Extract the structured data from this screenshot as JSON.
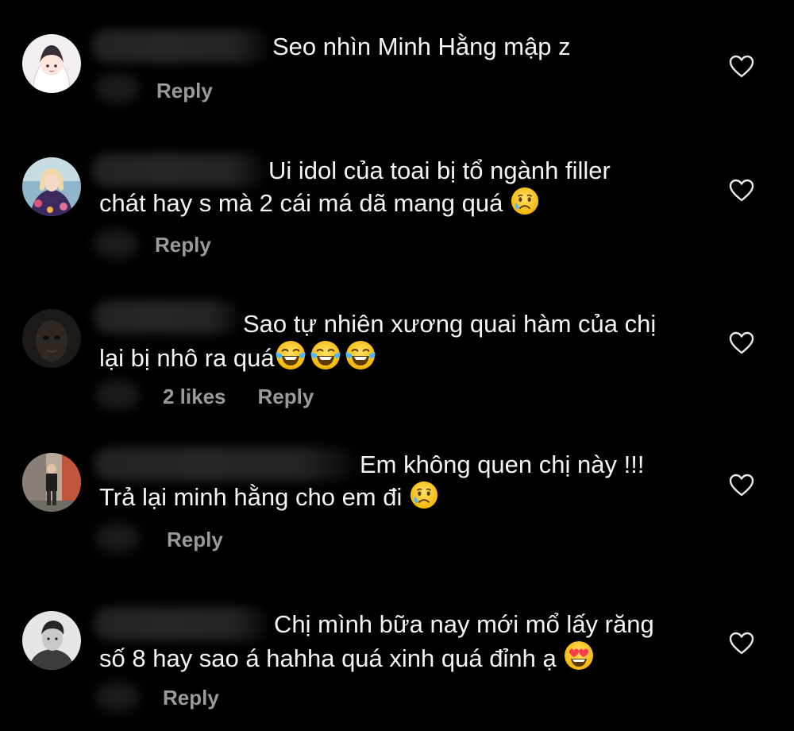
{
  "comments": [
    {
      "text_line1": "Seo nhìn Minh Hằng mập z",
      "text_line2": "",
      "likes": "",
      "reply_label": "Reply",
      "avatar": "cartoon-girl-white-hood",
      "emoji": []
    },
    {
      "text_line1": "Ui idol của toai bị tổ ngành filler",
      "text_line2": "chát hay s mà 2 cái má dã mang quá",
      "likes": "",
      "reply_label": "Reply",
      "avatar": "woman-floral-dress",
      "emoji": [
        "crying-face"
      ]
    },
    {
      "text_line1": "Sao tự nhiên xương quai hàm của chị",
      "text_line2": "lại bị nhô ra quá",
      "likes": "2 likes",
      "reply_label": "Reply",
      "avatar": "dark-face-photo",
      "emoji": [
        "tears-of-joy",
        "tears-of-joy",
        "tears-of-joy"
      ]
    },
    {
      "text_line1": "Em không quen chị này !!!",
      "text_line2": "Trả lại minh hằng cho em đi",
      "likes": "",
      "reply_label": "Reply",
      "avatar": "man-standing-outdoors",
      "emoji": [
        "crying-face"
      ]
    },
    {
      "text_line1": "Chị mình bữa nay mới mổ lấy răng",
      "text_line2": "số 8 hay sao á hahha quá xinh quá đỉnh ạ",
      "likes": "",
      "reply_label": "Reply",
      "avatar": "man-grayscale-portrait",
      "emoji": [
        "heart-eyes"
      ]
    }
  ],
  "icons": {
    "like": "heart-outline-icon"
  },
  "colors": {
    "background": "#000000",
    "text": "#f4f4f4",
    "meta": "#9a9a9a"
  }
}
